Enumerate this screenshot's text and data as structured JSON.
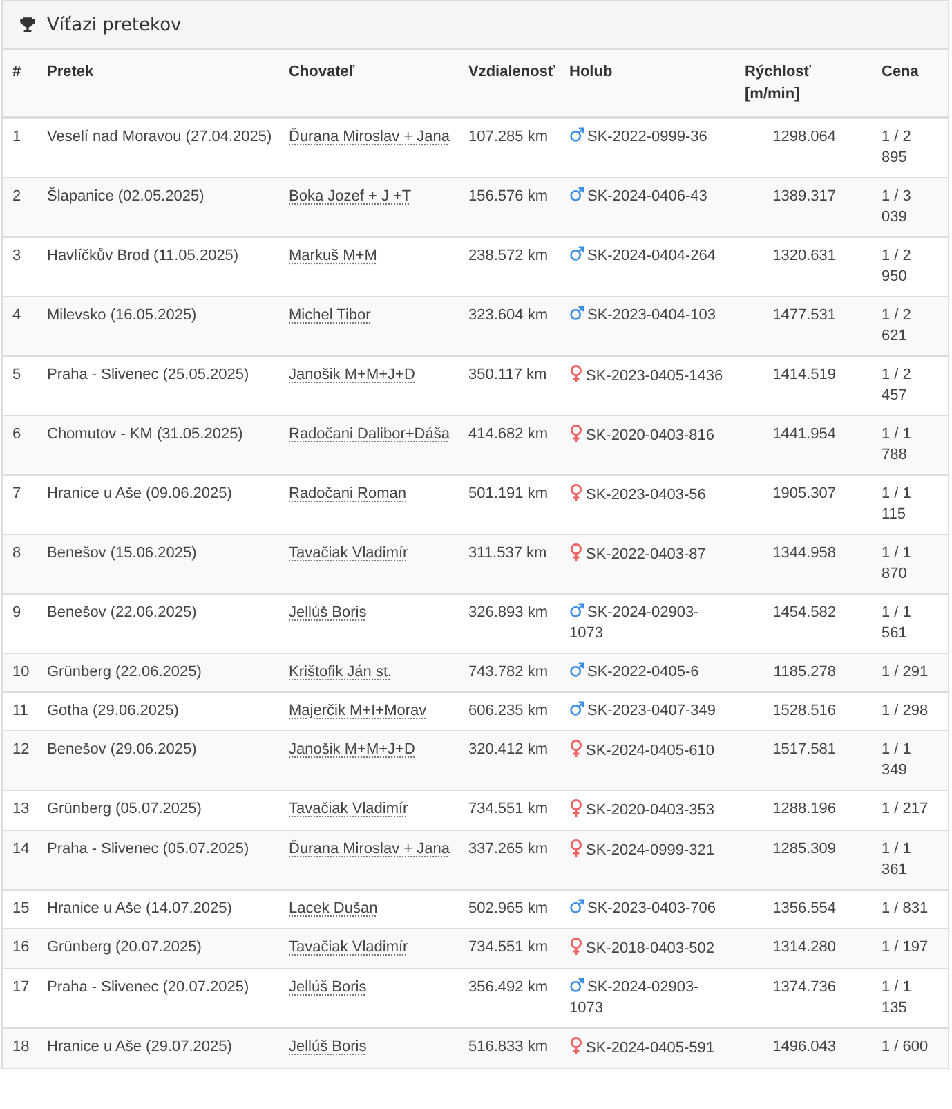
{
  "panel": {
    "title": "Víťazi pretekov"
  },
  "table": {
    "columns": [
      "#",
      "Pretek",
      "Chovateľ",
      "Vzdialenosť",
      "Holub",
      "Rýchlosť [m/min]",
      "Cena"
    ],
    "rows": [
      {
        "number": "1",
        "race": "Veselí nad Moravou (27.04.2025)",
        "breeder": "Ďurana Miroslav + Jana",
        "distance": "107.285 km",
        "kind": "male",
        "pigeon": "SK-2022-0999-36",
        "speed": "1298.064",
        "prize": "1 / 2 895"
      },
      {
        "number": "2",
        "race": "Šlapanice (02.05.2025)",
        "breeder": "Boka Jozef + J +T",
        "distance": "156.576 km",
        "kind": "male",
        "pigeon": "SK-2024-0406-43",
        "speed": "1389.317",
        "prize": "1 / 3 039"
      },
      {
        "number": "3",
        "race": "Havlíčkův Brod (11.05.2025)",
        "breeder": "Markuš M+M",
        "distance": "238.572 km",
        "kind": "male",
        "pigeon": "SK-2024-0404-264",
        "speed": "1320.631",
        "prize": "1 / 2 950"
      },
      {
        "number": "4",
        "race": "Milevsko (16.05.2025)",
        "breeder": "Michel Tibor",
        "distance": "323.604 km",
        "kind": "male",
        "pigeon": "SK-2023-0404-103",
        "speed": "1477.531",
        "prize": "1 / 2 621"
      },
      {
        "number": "5",
        "race": "Praha - Slivenec (25.05.2025)",
        "breeder": "Janošik M+M+J+D",
        "distance": "350.117 km",
        "kind": "female",
        "pigeon": "SK-2023-0405-1436",
        "speed": "1414.519",
        "prize": "1 / 2 457"
      },
      {
        "number": "6",
        "race": "Chomutov - KM (31.05.2025)",
        "breeder": "Radočani Dalibor+Dáša",
        "distance": "414.682 km",
        "kind": "female",
        "pigeon": "SK-2020-0403-816",
        "speed": "1441.954",
        "prize": "1 / 1 788"
      },
      {
        "number": "7",
        "race": "Hranice u Aše (09.06.2025)",
        "breeder": "Radočani Roman",
        "distance": "501.191 km",
        "kind": "female",
        "pigeon": "SK-2023-0403-56",
        "speed": "1905.307",
        "prize": "1 / 1 115"
      },
      {
        "number": "8",
        "race": "Benešov (15.06.2025)",
        "breeder": "Tavačiak Vladimír",
        "distance": "311.537 km",
        "kind": "female",
        "pigeon": "SK-2022-0403-87",
        "speed": "1344.958",
        "prize": "1 / 1 870"
      },
      {
        "number": "9",
        "race": "Benešov (22.06.2025)",
        "breeder": "Jellúš Boris",
        "distance": "326.893 km",
        "kind": "male",
        "pigeon": "SK-2024-02903-1073",
        "speed": "1454.582",
        "prize": "1 / 1 561"
      },
      {
        "number": "10",
        "race": "Grünberg (22.06.2025)",
        "breeder": "Krištofik Ján st.",
        "distance": "743.782 km",
        "kind": "male",
        "pigeon": "SK-2022-0405-6",
        "speed": "1185.278",
        "prize": "1 / 291"
      },
      {
        "number": "11",
        "race": "Gotha (29.06.2025)",
        "breeder": "Majerčik M+I+Morav",
        "distance": "606.235 km",
        "kind": "male",
        "pigeon": "SK-2023-0407-349",
        "speed": "1528.516",
        "prize": "1 / 298"
      },
      {
        "number": "12",
        "race": "Benešov (29.06.2025)",
        "breeder": "Janošik M+M+J+D",
        "distance": "320.412 km",
        "kind": "female",
        "pigeon": "SK-2024-0405-610",
        "speed": "1517.581",
        "prize": "1 / 1 349"
      },
      {
        "number": "13",
        "race": "Grünberg (05.07.2025)",
        "breeder": "Tavačiak Vladimír",
        "distance": "734.551 km",
        "kind": "female",
        "pigeon": "SK-2020-0403-353",
        "speed": "1288.196",
        "prize": "1 / 217"
      },
      {
        "number": "14",
        "race": "Praha - Slivenec (05.07.2025)",
        "breeder": "Ďurana Miroslav + Jana",
        "distance": "337.265 km",
        "kind": "female",
        "pigeon": "SK-2024-0999-321",
        "speed": "1285.309",
        "prize": "1 / 1 361"
      },
      {
        "number": "15",
        "race": "Hranice u Aše (14.07.2025)",
        "breeder": "Lacek Dušan",
        "distance": "502.965 km",
        "kind": "male",
        "pigeon": "SK-2023-0403-706",
        "speed": "1356.554",
        "prize": "1 / 831"
      },
      {
        "number": "16",
        "race": "Grünberg (20.07.2025)",
        "breeder": "Tavačiak Vladimír",
        "distance": "734.551 km",
        "kind": "female",
        "pigeon": "SK-2018-0403-502",
        "speed": "1314.280",
        "prize": "1 / 197"
      },
      {
        "number": "17",
        "race": "Praha - Slivenec (20.07.2025)",
        "breeder": "Jellúš Boris",
        "distance": "356.492 km",
        "kind": "male",
        "pigeon": "SK-2024-02903-1073",
        "speed": "1374.736",
        "prize": "1 / 1 135"
      },
      {
        "number": "18",
        "race": "Hranice u Aše (29.07.2025)",
        "breeder": "Jellúš Boris",
        "distance": "516.833 km",
        "kind": "female",
        "pigeon": "SK-2024-0405-591",
        "speed": "1496.043",
        "prize": "1 / 600"
      }
    ]
  }
}
